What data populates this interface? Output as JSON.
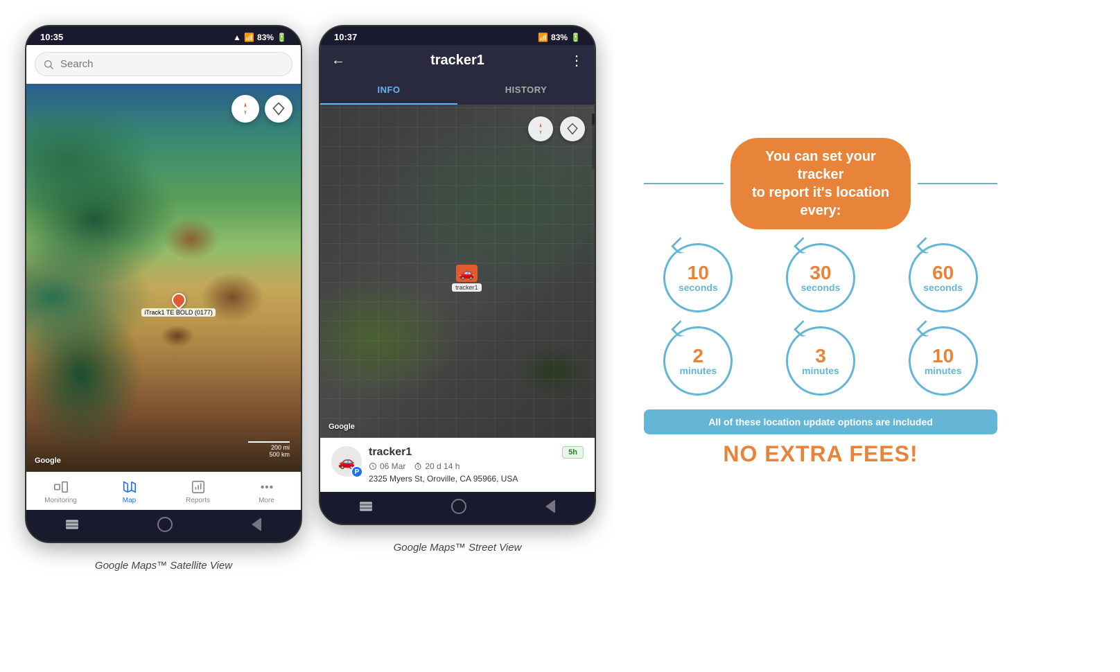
{
  "page": {
    "background": "#ffffff"
  },
  "phone1": {
    "status_bar": {
      "time": "10:35",
      "signal": "▲▲▲",
      "network": ".il",
      "battery": "83%",
      "battery_icon": "🔋"
    },
    "search": {
      "placeholder": "Search"
    },
    "map": {
      "pin_label": "iTrack1 TE BOLD (0177)",
      "scale_200mi": "200 mi",
      "scale_500km": "500 km",
      "google_label": "Google"
    },
    "nav": {
      "monitoring": "Monitoring",
      "map": "Map",
      "reports": "Reports",
      "more": "More"
    },
    "caption": "Google Maps™ Satellite View"
  },
  "phone2": {
    "status_bar": {
      "time": "10:37",
      "signal": "▲▲▲",
      "network": ".il",
      "battery": "83%",
      "battery_icon": "🔋"
    },
    "header": {
      "back_label": "←",
      "title": "tracker1",
      "menu_label": "⋮"
    },
    "tabs": {
      "info": "INFO",
      "history": "HISTORY"
    },
    "map": {
      "tracker_label": "tracker1",
      "google_label": "Google"
    },
    "tracker_card": {
      "name": "tracker1",
      "p_badge": "P",
      "date": "06 Mar",
      "duration": "20 d 14 h",
      "address": "2325 Myers St, Oroville, CA 95966, USA",
      "badge": "5h"
    },
    "caption": "Google Maps™ Street View"
  },
  "infographic": {
    "title_line1": "You can set your tracker",
    "title_line2": "to report it's location every:",
    "intervals": [
      {
        "number": "10",
        "unit": "seconds"
      },
      {
        "number": "30",
        "unit": "seconds"
      },
      {
        "number": "60",
        "unit": "seconds"
      },
      {
        "number": "2",
        "unit": "minutes"
      },
      {
        "number": "3",
        "unit": "minutes"
      },
      {
        "number": "10",
        "unit": "minutes"
      }
    ],
    "banner_text": "All of these location update options are included",
    "no_fees": "NO EXTRA FEES!"
  }
}
